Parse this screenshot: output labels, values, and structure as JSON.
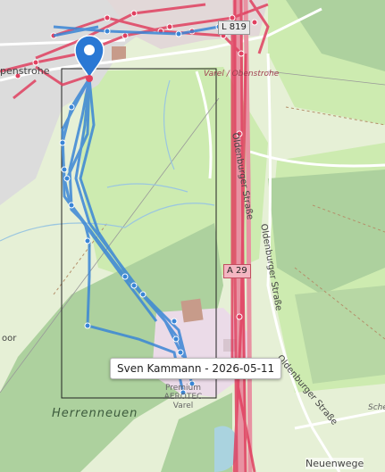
{
  "map": {
    "places": {
      "town_fragment": "penstrohe",
      "town_road_label": "Varel / Obenstrohe",
      "herrenneuen": "Herrenneuen",
      "neuenwege": "Neuenwege",
      "oldenburger_strasse_1": "Oldenburger Straße",
      "oldenburger_strasse_2": "Oldenburger Straße",
      "oldenburger_strasse_3": "Oldenburger Straße",
      "airfield": "Premium AEROTEC Varel",
      "left_fragment": "oor",
      "right_fragment": "Sche"
    },
    "roads": {
      "l819": "L 819",
      "a29": "A 29"
    },
    "tooltip": "Sven Kammann - 2026-05-11",
    "colors": {
      "track_blue": "#3a86d6",
      "track_red": "#e04060",
      "marker": "#2a78d4",
      "forest": "#add19e",
      "meadow": "#cdebb0"
    }
  }
}
